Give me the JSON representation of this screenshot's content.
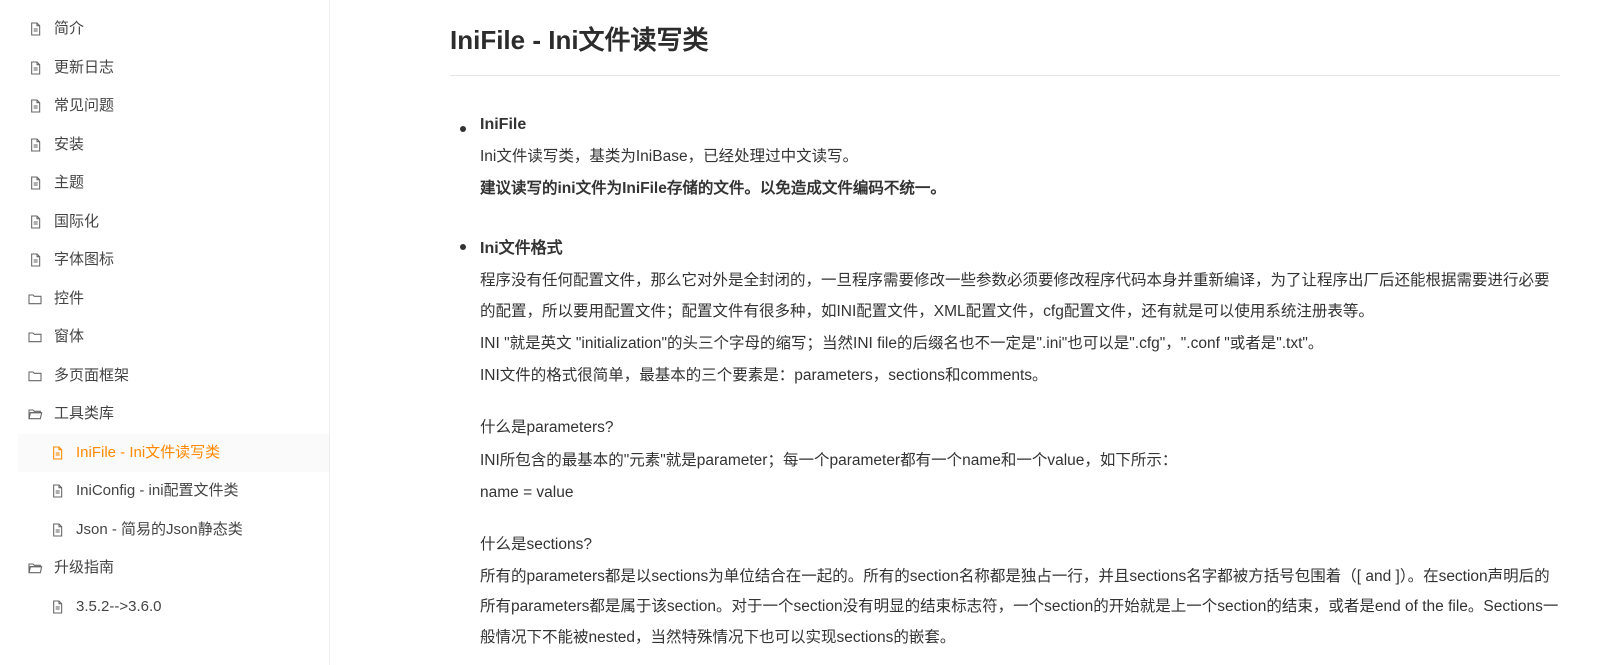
{
  "sidebar": {
    "items": [
      {
        "label": "简介",
        "icon": "doc",
        "indent": 0,
        "active": false
      },
      {
        "label": "更新日志",
        "icon": "doc",
        "indent": 0,
        "active": false
      },
      {
        "label": "常见问题",
        "icon": "doc",
        "indent": 0,
        "active": false
      },
      {
        "label": "安装",
        "icon": "doc",
        "indent": 0,
        "active": false
      },
      {
        "label": "主题",
        "icon": "doc",
        "indent": 0,
        "active": false
      },
      {
        "label": "国际化",
        "icon": "doc",
        "indent": 0,
        "active": false
      },
      {
        "label": "字体图标",
        "icon": "doc",
        "indent": 0,
        "active": false
      },
      {
        "label": "控件",
        "icon": "folder",
        "indent": 0,
        "active": false
      },
      {
        "label": "窗体",
        "icon": "folder",
        "indent": 0,
        "active": false
      },
      {
        "label": "多页面框架",
        "icon": "folder",
        "indent": 0,
        "active": false
      },
      {
        "label": "工具类库",
        "icon": "folder-open",
        "indent": 0,
        "active": false
      },
      {
        "label": "IniFile - Ini文件读写类",
        "icon": "doc",
        "indent": 1,
        "active": true
      },
      {
        "label": "IniConfig - ini配置文件类",
        "icon": "doc",
        "indent": 1,
        "active": false
      },
      {
        "label": "Json - 简易的Json静态类",
        "icon": "doc",
        "indent": 1,
        "active": false
      },
      {
        "label": "升级指南",
        "icon": "folder-open",
        "indent": 0,
        "active": false
      },
      {
        "label": "3.5.2-->3.6.0",
        "icon": "doc",
        "indent": 1,
        "active": false
      }
    ]
  },
  "page": {
    "title": "IniFile - Ini文件读写类",
    "bullets": [
      {
        "title": "IniFile",
        "paras": [
          {
            "text": "Ini文件读写类，基类为IniBase，已经处理过中文读写。",
            "strong": false
          },
          {
            "text": "建议读写的ini文件为IniFile存储的文件。以免造成文件编码不统一。",
            "strong": true
          }
        ],
        "subblocks": []
      },
      {
        "title": "Ini文件格式",
        "paras": [
          {
            "text": "程序没有任何配置文件，那么它对外是全封闭的，一旦程序需要修改一些参数必须要修改程序代码本身并重新编译，为了让程序出厂后还能根据需要进行必要的配置，所以要用配置文件；配置文件有很多种，如INI配置文件，XML配置文件，cfg配置文件，还有就是可以使用系统注册表等。",
            "strong": false
          },
          {
            "text": "INI \"就是英文 \"initialization\"的头三个字母的缩写；当然INI file的后缀名也不一定是\".ini\"也可以是\".cfg\"，\".conf \"或者是\".txt\"。",
            "strong": false
          },
          {
            "text": "INI文件的格式很简单，最基本的三个要素是：parameters，sections和comments。",
            "strong": false
          }
        ],
        "subblocks": [
          {
            "paras": [
              {
                "text": "什么是parameters?",
                "strong": false
              },
              {
                "text": "INI所包含的最基本的\"元素\"就是parameter；每一个parameter都有一个name和一个value，如下所示：",
                "strong": false
              },
              {
                "text": "name = value",
                "strong": false
              }
            ]
          },
          {
            "paras": [
              {
                "text": "什么是sections?",
                "strong": false
              },
              {
                "text": "所有的parameters都是以sections为单位结合在一起的。所有的section名称都是独占一行，并且sections名字都被方括号包围着（[ and ]）。在section声明后的所有parameters都是属于该section。对于一个section没有明显的结束标志符，一个section的开始就是上一个section的结束，或者是end of the file。Sections一般情况下不能被nested，当然特殊情况下也可以实现sections的嵌套。",
                "strong": false
              }
            ]
          }
        ]
      }
    ]
  }
}
